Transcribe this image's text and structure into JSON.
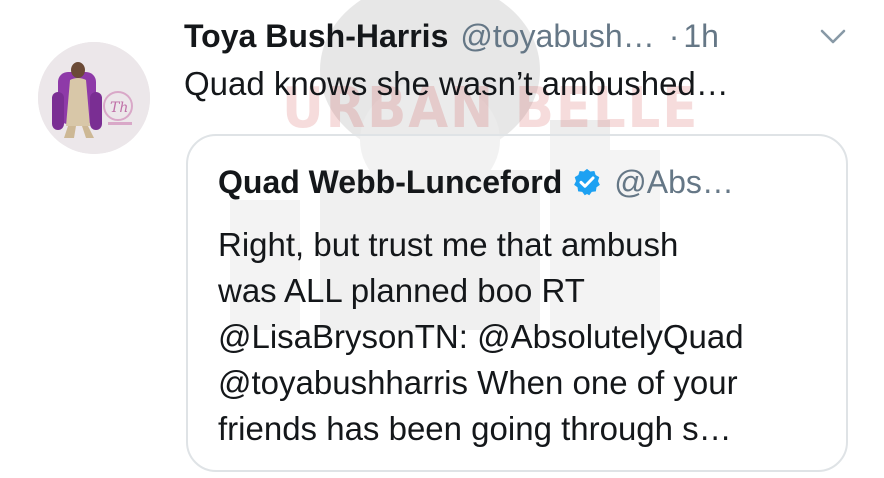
{
  "tweet": {
    "display_name": "Toya Bush-Harris",
    "handle": "@toyabush…",
    "separator": "·",
    "time": "1h",
    "text": "Quad knows she wasn’t ambushed…",
    "menu_icon": "chevron-down-icon",
    "avatar_icon": "profile-avatar"
  },
  "watermark": {
    "text": "URBAN BELLE"
  },
  "quote": {
    "display_name": "Quad Webb-Lunceford",
    "verified_icon": "verified-badge-icon",
    "handle": "@Abs…",
    "lines": [
      "Right, but trust me that ambush",
      "was ALL planned boo RT",
      "@LisaBrysonTN: @AbsolutelyQuad",
      "@toyabushharris When one of your",
      "friends has been going through s…"
    ]
  },
  "colors": {
    "text_primary": "#14171a",
    "text_secondary": "#657786",
    "verified_blue": "#1da1f2",
    "card_border": "#dfe3e6",
    "watermark_red": "#c82828"
  }
}
